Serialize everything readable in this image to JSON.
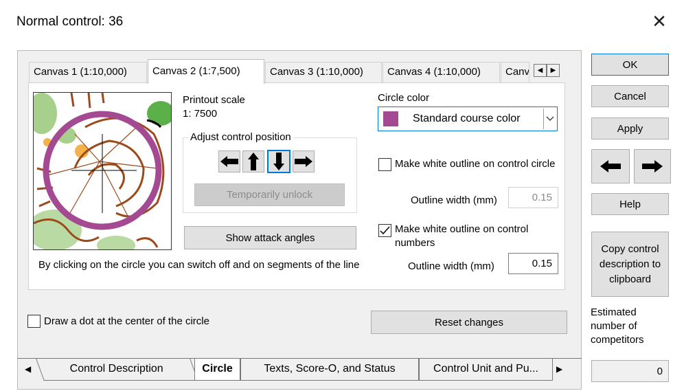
{
  "window": {
    "title": "Normal control: 36"
  },
  "canvas_tabs": [
    {
      "label": "Canvas 1  (1:10,000)",
      "active": false
    },
    {
      "label": "Canvas 2  (1:7,500)",
      "active": true
    },
    {
      "label": "Canvas 3  (1:10,000)",
      "active": false
    },
    {
      "label": "Canvas 4  (1:10,000)",
      "active": false
    },
    {
      "label": "Canv",
      "active": false
    }
  ],
  "tab_scroll": {
    "left": "◀",
    "right": "▶"
  },
  "scale": {
    "label": "Printout scale",
    "value": "1: 7500"
  },
  "adjust": {
    "label": "Adjust control position",
    "unlock": "Temporarily unlock"
  },
  "attack_button": "Show attack angles",
  "hint": "By clicking on the circle you can switch off and on segments of the line",
  "circle_color": {
    "label": "Circle color",
    "value": "Standard course color",
    "swatch": "#a34a92"
  },
  "outline_circle": {
    "label": "Make white outline on control circle",
    "checked": false,
    "width_label": "Outline width (mm)",
    "width_value": "0.15"
  },
  "outline_numbers": {
    "label": "Make white outline on control numbers",
    "checked": true,
    "width_label": "Outline width (mm)",
    "width_value": "0.15"
  },
  "dot_checkbox": {
    "label": "Draw a dot at the center of the circle",
    "checked": false
  },
  "reset_button": "Reset changes",
  "right_panel": {
    "ok": "OK",
    "cancel": "Cancel",
    "apply": "Apply",
    "help": "Help",
    "copy": "Copy control description to clipboard",
    "estimated_label": "Estimated number of competitors",
    "estimated_value": "0"
  },
  "bottom_tabs": [
    {
      "label": "Control Description",
      "active": false
    },
    {
      "label": "Circle",
      "active": true
    },
    {
      "label": "Texts, Score-O, and Status",
      "active": false
    },
    {
      "label": "Control Unit and Pu...",
      "active": false
    }
  ],
  "colors": {
    "accent": "#0078d7",
    "circle": "#a34a92"
  }
}
